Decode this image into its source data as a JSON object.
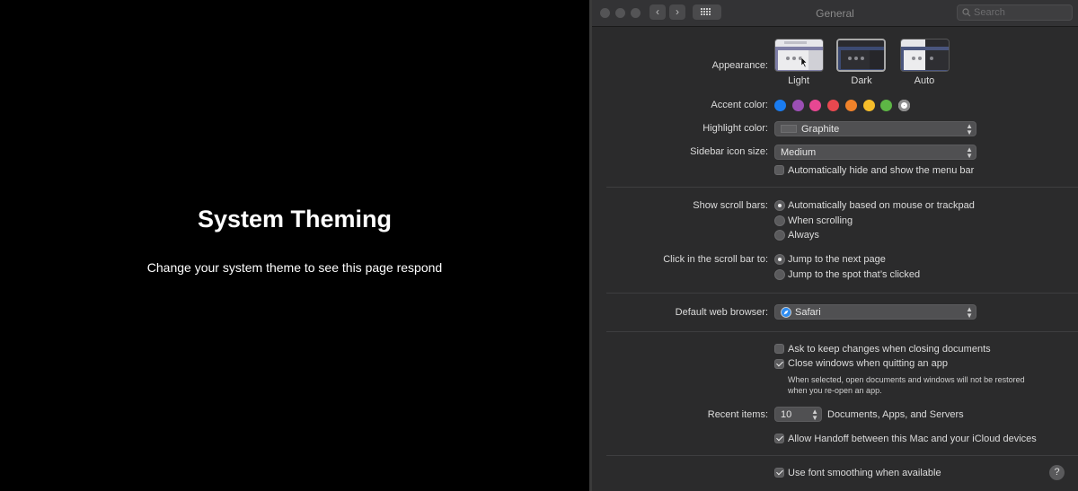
{
  "left": {
    "title": "System Theming",
    "subtitle": "Change your system theme to see this page respond"
  },
  "window": {
    "title": "General",
    "search_placeholder": "Search",
    "back_icon": "chevron-left-icon",
    "forward_icon": "chevron-right-icon",
    "grid_icon": "grid-icon"
  },
  "appearance": {
    "label": "Appearance:",
    "options": [
      "Light",
      "Dark",
      "Auto"
    ],
    "selected": "Dark"
  },
  "accent": {
    "label": "Accent color:",
    "colors": [
      "#1a7cf0",
      "#9b4fb4",
      "#e74792",
      "#e9484f",
      "#f0822a",
      "#f5bd2a",
      "#5db645",
      "#8c8c8c"
    ]
  },
  "highlight": {
    "label": "Highlight color:",
    "value": "Graphite"
  },
  "sidebar_icon": {
    "label": "Sidebar icon size:",
    "value": "Medium"
  },
  "menu_bar": {
    "label": "Automatically hide and show the menu bar",
    "checked": false
  },
  "scroll_bars": {
    "label": "Show scroll bars:",
    "options": [
      "Automatically based on mouse or trackpad",
      "When scrolling",
      "Always"
    ],
    "selected": 0
  },
  "click_scroll": {
    "label": "Click in the scroll bar to:",
    "options": [
      "Jump to the next page",
      "Jump to the spot that’s clicked"
    ],
    "selected": 0
  },
  "browser": {
    "label": "Default web browser:",
    "value": "Safari",
    "icon": "safari-icon"
  },
  "documents": {
    "ask_label": "Ask to keep changes when closing documents",
    "ask_checked": false,
    "close_label": "Close windows when quitting an app",
    "close_checked": true,
    "note_line1": "When selected, open documents and windows will not be restored",
    "note_line2": "when you re-open an app."
  },
  "recent": {
    "label": "Recent items:",
    "value": "10",
    "suffix": "Documents, Apps, and Servers"
  },
  "handoff": {
    "label": "Allow Handoff between this Mac and your iCloud devices",
    "checked": true
  },
  "smoothing": {
    "label": "Use font smoothing when available",
    "checked": true
  },
  "help": "?"
}
